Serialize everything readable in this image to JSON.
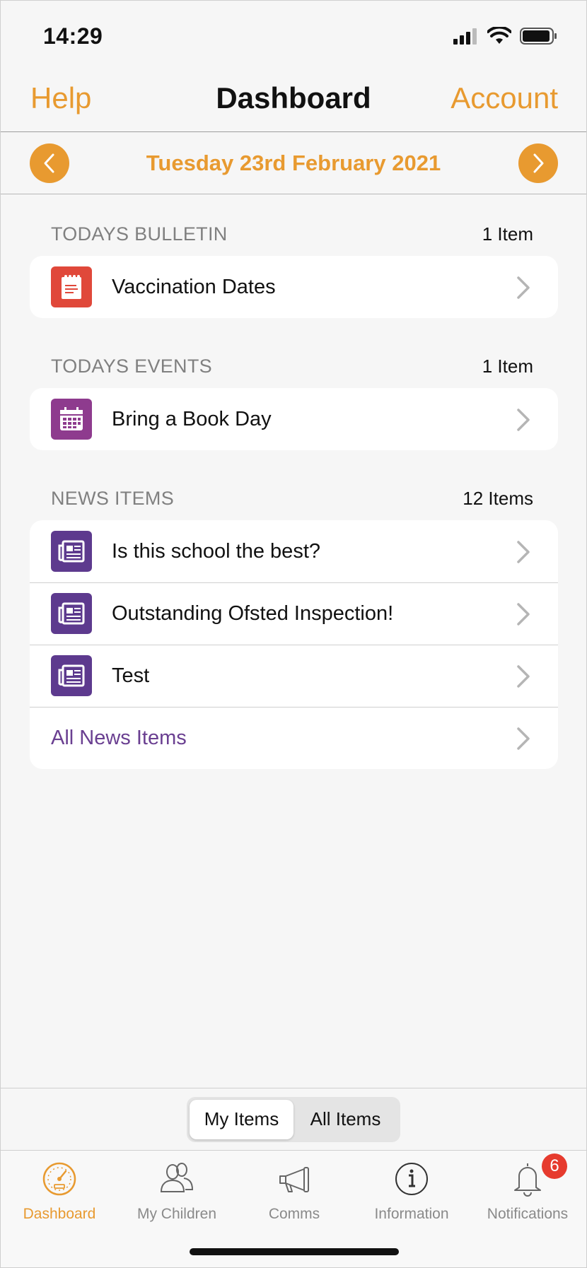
{
  "status_bar": {
    "time": "14:29"
  },
  "nav": {
    "left": "Help",
    "title": "Dashboard",
    "right": "Account"
  },
  "date_bar": {
    "date": "Tuesday 23rd February 2021"
  },
  "bulletin": {
    "title": "TODAYS BULLETIN",
    "count": "1 Item",
    "items": [
      {
        "label": "Vaccination Dates",
        "icon": "notepad-icon"
      }
    ]
  },
  "events": {
    "title": "TODAYS EVENTS",
    "count": "1 Item",
    "items": [
      {
        "label": "Bring a Book Day",
        "icon": "calendar-icon"
      }
    ]
  },
  "news": {
    "title": "NEWS ITEMS",
    "count": "12 Items",
    "items": [
      {
        "label": "Is this school the best?",
        "icon": "newspaper-icon"
      },
      {
        "label": "Outstanding Ofsted Inspection!",
        "icon": "newspaper-icon"
      },
      {
        "label": "Test",
        "icon": "newspaper-icon"
      }
    ],
    "all_link": "All News Items"
  },
  "toolbar": {
    "segments": [
      "My Items",
      "All Items"
    ],
    "selected": "My Items"
  },
  "tabs": [
    {
      "label": "Dashboard",
      "icon": "speedometer-icon"
    },
    {
      "label": "My Children",
      "icon": "people-icon"
    },
    {
      "label": "Comms",
      "icon": "megaphone-icon"
    },
    {
      "label": "Information",
      "icon": "info-icon"
    },
    {
      "label": "Notifications",
      "icon": "bell-icon",
      "badge": "6"
    }
  ],
  "colors": {
    "accent": "#e89a30",
    "bulletin_icon": "#e0483a",
    "event_icon": "#8e3b8e",
    "news_icon": "#5d3a8e",
    "link": "#6a3f91",
    "badge": "#e63b2e"
  }
}
